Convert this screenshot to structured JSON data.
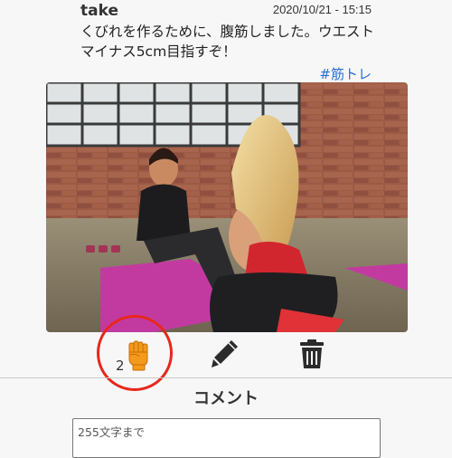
{
  "post": {
    "username": "take",
    "timestamp": "2020/10/21 - 15:15",
    "text": "くびれを作るために、腹筋しました。ウエストマイナス5cm目指すぞ！",
    "hashtag": "#筋トレ",
    "image_description": "Two women exercising on pink yoga mats in a brick-walled gym",
    "like_count": "2"
  },
  "icons": {
    "like": "raised-fist-icon",
    "edit": "pencil-icon",
    "delete": "trash-icon"
  },
  "colors": {
    "like_icon": "#f39a1c",
    "hashtag": "#2a6fd6",
    "highlight": "#e8271c"
  },
  "comments": {
    "heading": "コメント",
    "placeholder": "255文字まで"
  }
}
